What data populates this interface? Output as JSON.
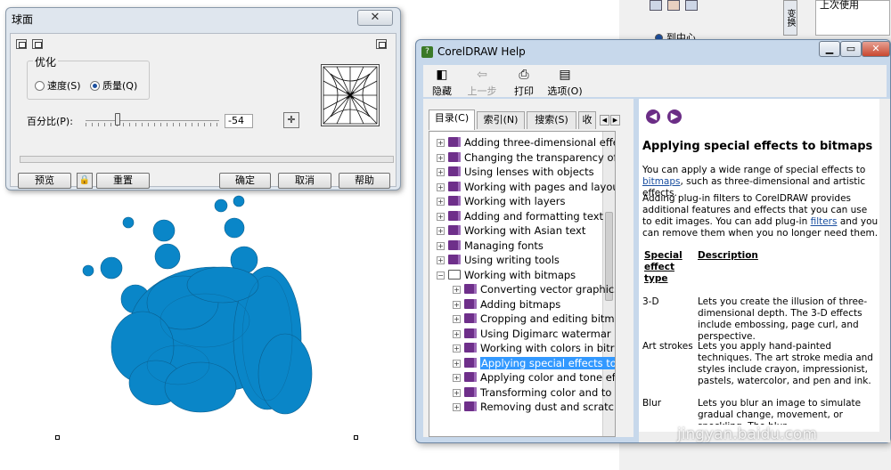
{
  "sphere_dialog": {
    "title": "球面",
    "optimize": {
      "group_label": "优化",
      "speed_label": "速度(S)",
      "quality_label": "质量(Q)",
      "selected": "quality"
    },
    "percent_label": "百分比(P):",
    "percent_value": "-54",
    "buttons": {
      "preview": "预览",
      "reset": "重置",
      "ok": "确定",
      "cancel": "取消",
      "help": "帮助"
    }
  },
  "help_window": {
    "title": "CorelDRAW Help",
    "toolbar": {
      "hide": "隐藏",
      "back": "上一步",
      "print": "打印",
      "options": "选项(O)"
    },
    "tabs": [
      "目录(C)",
      "索引(N)",
      "搜索(S)",
      "收"
    ],
    "toc_items": [
      {
        "label": "Adding three-dimensional effe",
        "level": 0,
        "expanded": false,
        "selected": false
      },
      {
        "label": "Changing the transparency of",
        "level": 0,
        "expanded": false,
        "selected": false
      },
      {
        "label": "Using lenses with objects",
        "level": 0,
        "expanded": false,
        "selected": false
      },
      {
        "label": "Working with pages and layou",
        "level": 0,
        "expanded": false,
        "selected": false
      },
      {
        "label": "Working with layers",
        "level": 0,
        "expanded": false,
        "selected": false
      },
      {
        "label": "Adding and formatting text",
        "level": 0,
        "expanded": false,
        "selected": false
      },
      {
        "label": "Working with Asian text",
        "level": 0,
        "expanded": false,
        "selected": false
      },
      {
        "label": "Managing fonts",
        "level": 0,
        "expanded": false,
        "selected": false
      },
      {
        "label": "Using writing tools",
        "level": 0,
        "expanded": false,
        "selected": false
      },
      {
        "label": "Working with bitmaps",
        "level": 0,
        "expanded": true,
        "selected": false
      },
      {
        "label": "Converting vector graphics",
        "level": 1,
        "expanded": false,
        "selected": false
      },
      {
        "label": "Adding bitmaps",
        "level": 1,
        "expanded": false,
        "selected": false
      },
      {
        "label": "Cropping and editing bitm",
        "level": 1,
        "expanded": false,
        "selected": false
      },
      {
        "label": "Using Digimarc watermar",
        "level": 1,
        "expanded": false,
        "selected": false
      },
      {
        "label": "Working with colors in bitr",
        "level": 1,
        "expanded": false,
        "selected": false
      },
      {
        "label": "Applying special effects to",
        "level": 1,
        "expanded": false,
        "selected": true
      },
      {
        "label": "Applying color and tone ef",
        "level": 1,
        "expanded": false,
        "selected": false
      },
      {
        "label": "Transforming color and to",
        "level": 1,
        "expanded": false,
        "selected": false
      },
      {
        "label": "Removing dust and scratc",
        "level": 1,
        "expanded": false,
        "selected": false
      }
    ],
    "content": {
      "heading": "Applying special effects to bitmaps",
      "p1_before": "You can apply a wide range of special effects to ",
      "p1_link": "bitmaps",
      "p1_after": ", such as three-dimensional and artistic effects.",
      "p2_before": "Adding plug-in filters to CorelDRAW provides additional features and effects that you can use to edit images. You can add plug-in ",
      "p2_link": "filters",
      "p2_after": " and you can remove them when you no longer need them.",
      "table_headers": [
        "Special effect type",
        "Description"
      ],
      "rows": [
        {
          "type": "3-D",
          "desc": "Lets you create the illusion of three-dimensional depth. The 3-D effects include embossing, page curl, and perspective."
        },
        {
          "type": "Art strokes",
          "desc": "Lets you apply hand-painted techniques. The art stroke media and styles include crayon, impressionist, pastels, watercolor, and pen and ink."
        },
        {
          "type": "Blur",
          "desc": "Lets you blur an image to simulate gradual change, movement, or speckling. The blur"
        }
      ]
    }
  },
  "right_panel": {
    "top_text": "上次使用",
    "radio_label": "到中心",
    "side_tab": "变换"
  },
  "watermark": "jingyan.baidu.com",
  "colors": {
    "blob": "#0a86c8",
    "selection": "#3399ff",
    "book": "#6e2f8a"
  }
}
